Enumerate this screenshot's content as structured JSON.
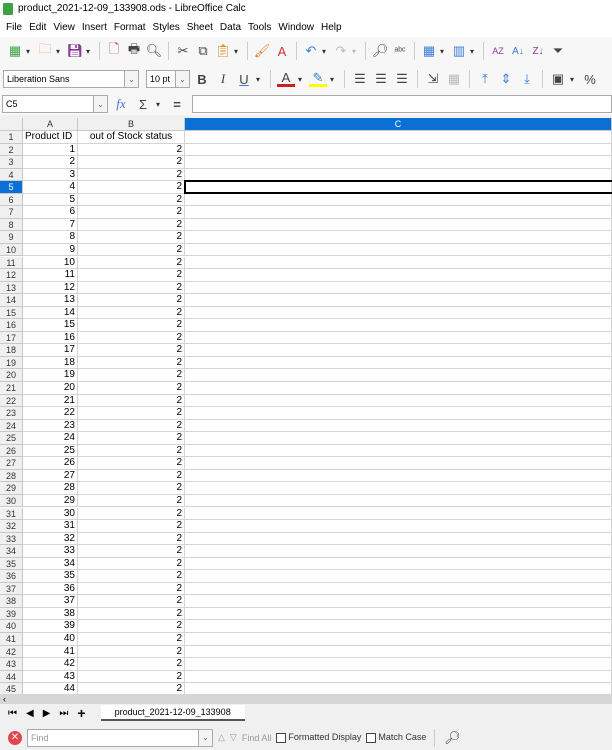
{
  "window": {
    "title": "product_2021-12-09_133908.ods - LibreOffice Calc"
  },
  "menu": [
    "File",
    "Edit",
    "View",
    "Insert",
    "Format",
    "Styles",
    "Sheet",
    "Data",
    "Tools",
    "Window",
    "Help"
  ],
  "format": {
    "font_name": "Liberation Sans",
    "font_size": "10 pt",
    "bold": "B",
    "italic": "I",
    "underline": "U",
    "font_color": "A",
    "percent": "%",
    "font_color_hex": "#c9211e",
    "highlight_hex": "#ffff00"
  },
  "formula": {
    "cell_ref": "C5",
    "fx": "fx",
    "sigma": "Σ",
    "equals": "=",
    "content": ""
  },
  "columns": [
    "A",
    "B",
    "C"
  ],
  "selected_column": "C",
  "selected_row": 5,
  "header_row": {
    "row": "1",
    "A": "Product ID",
    "B": "out of Stock status"
  },
  "rows": [
    {
      "n": "2",
      "a": "1",
      "b": "2"
    },
    {
      "n": "3",
      "a": "2",
      "b": "2"
    },
    {
      "n": "4",
      "a": "3",
      "b": "2"
    },
    {
      "n": "5",
      "a": "4",
      "b": "2"
    },
    {
      "n": "6",
      "a": "5",
      "b": "2"
    },
    {
      "n": "7",
      "a": "6",
      "b": "2"
    },
    {
      "n": "8",
      "a": "7",
      "b": "2"
    },
    {
      "n": "9",
      "a": "8",
      "b": "2"
    },
    {
      "n": "10",
      "a": "9",
      "b": "2"
    },
    {
      "n": "11",
      "a": "10",
      "b": "2"
    },
    {
      "n": "12",
      "a": "11",
      "b": "2"
    },
    {
      "n": "13",
      "a": "12",
      "b": "2"
    },
    {
      "n": "14",
      "a": "13",
      "b": "2"
    },
    {
      "n": "15",
      "a": "14",
      "b": "2"
    },
    {
      "n": "16",
      "a": "15",
      "b": "2"
    },
    {
      "n": "17",
      "a": "16",
      "b": "2"
    },
    {
      "n": "18",
      "a": "17",
      "b": "2"
    },
    {
      "n": "19",
      "a": "18",
      "b": "2"
    },
    {
      "n": "20",
      "a": "19",
      "b": "2"
    },
    {
      "n": "21",
      "a": "20",
      "b": "2"
    },
    {
      "n": "22",
      "a": "21",
      "b": "2"
    },
    {
      "n": "23",
      "a": "22",
      "b": "2"
    },
    {
      "n": "24",
      "a": "23",
      "b": "2"
    },
    {
      "n": "25",
      "a": "24",
      "b": "2"
    },
    {
      "n": "26",
      "a": "25",
      "b": "2"
    },
    {
      "n": "27",
      "a": "26",
      "b": "2"
    },
    {
      "n": "28",
      "a": "27",
      "b": "2"
    },
    {
      "n": "29",
      "a": "28",
      "b": "2"
    },
    {
      "n": "30",
      "a": "29",
      "b": "2"
    },
    {
      "n": "31",
      "a": "30",
      "b": "2"
    },
    {
      "n": "32",
      "a": "31",
      "b": "2"
    },
    {
      "n": "33",
      "a": "32",
      "b": "2"
    },
    {
      "n": "34",
      "a": "33",
      "b": "2"
    },
    {
      "n": "35",
      "a": "34",
      "b": "2"
    },
    {
      "n": "36",
      "a": "35",
      "b": "2"
    },
    {
      "n": "37",
      "a": "36",
      "b": "2"
    },
    {
      "n": "38",
      "a": "37",
      "b": "2"
    },
    {
      "n": "39",
      "a": "38",
      "b": "2"
    },
    {
      "n": "40",
      "a": "39",
      "b": "2"
    },
    {
      "n": "41",
      "a": "40",
      "b": "2"
    },
    {
      "n": "42",
      "a": "41",
      "b": "2"
    },
    {
      "n": "43",
      "a": "42",
      "b": "2"
    },
    {
      "n": "44",
      "a": "43",
      "b": "2"
    },
    {
      "n": "45",
      "a": "44",
      "b": "2"
    }
  ],
  "sheet_tab": "product_2021-12-09_133908",
  "find": {
    "placeholder": "Find",
    "find_all": "Find All",
    "formatted_display": "Formatted Display",
    "match_case": "Match Case"
  }
}
